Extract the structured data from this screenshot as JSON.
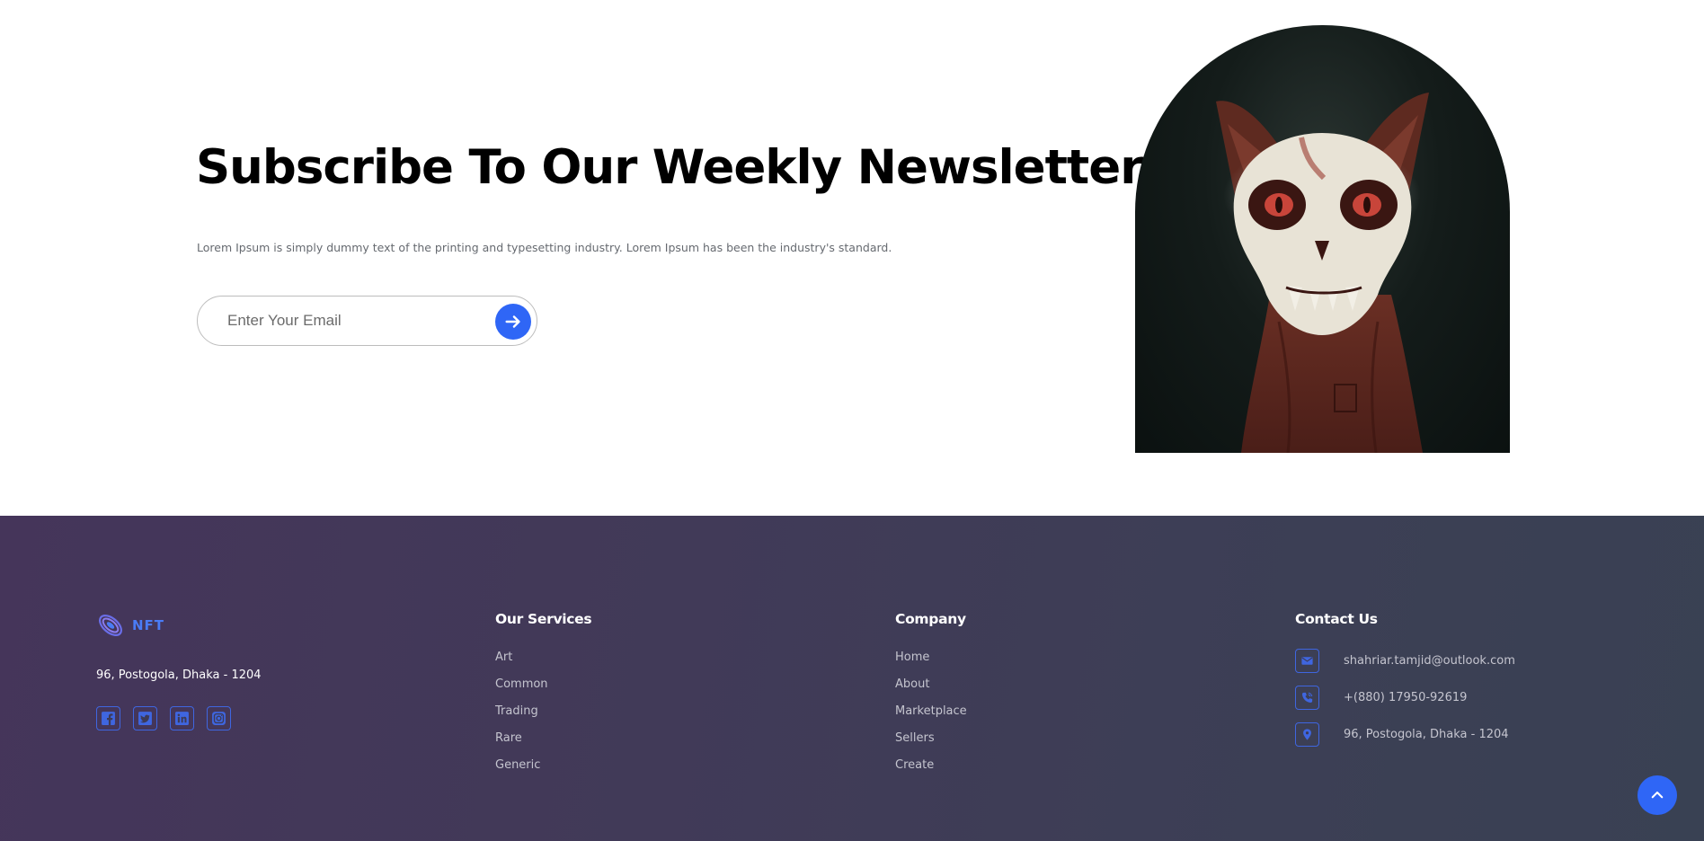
{
  "newsletter": {
    "title": "Subscribe To Our Weekly Newsletter",
    "description": "Lorem Ipsum is simply dummy text of the printing and typesetting industry. Lorem Ipsum has been the industry's standard.",
    "email_placeholder": "Enter Your Email",
    "submit_icon": "arrow-right-icon",
    "image": "skull-cat-nft-artwork"
  },
  "footer": {
    "logo_text": "NFT",
    "address": "96, Postogola, Dhaka - 1204",
    "socials": [
      {
        "icon": "facebook-icon"
      },
      {
        "icon": "twitter-icon"
      },
      {
        "icon": "linkedin-icon"
      },
      {
        "icon": "instagram-icon"
      }
    ],
    "services": {
      "title": "Our Services",
      "items": [
        "Art",
        "Common",
        "Trading",
        "Rare",
        "Generic"
      ]
    },
    "company": {
      "title": "Company",
      "items": [
        "Home",
        "About",
        "Marketplace",
        "Sellers",
        "Create"
      ]
    },
    "contact": {
      "title": "Contact Us",
      "email": "shahriar.tamjid@outlook.com",
      "phone": "+(880) 17950-92619",
      "address": "96, Postogola, Dhaka - 1204"
    }
  },
  "colors": {
    "accent": "#2f66f6",
    "footer_bg_start": "#45355a",
    "footer_bg_end": "#394153"
  },
  "scroll_top_icon": "chevron-up-icon"
}
